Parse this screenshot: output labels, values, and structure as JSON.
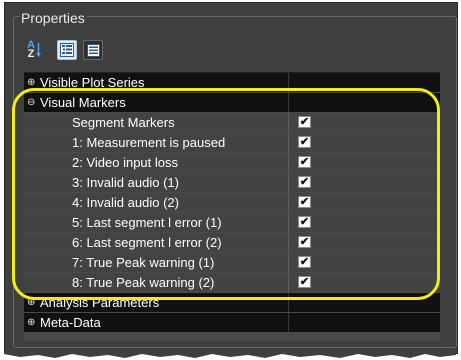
{
  "panel": {
    "title": "Properties"
  },
  "toolbar": {
    "sort_icon_top": "A",
    "sort_icon_bottom": "Z",
    "categorized_icon": "categorized-icon",
    "alphabetical_icon": "alphabetical-icon"
  },
  "grid": {
    "categories": {
      "visible_plot_series": "Visible Plot Series",
      "visual_markers": "Visual Markers",
      "analysis_parameters": "Analysis Parameters",
      "meta_data": "Meta-Data"
    },
    "visual_markers_items": [
      {
        "label": "Segment Markers",
        "checked": true
      },
      {
        "label": "1: Measurement is paused",
        "checked": true
      },
      {
        "label": "2: Video input loss",
        "checked": true
      },
      {
        "label": "3: Invalid audio (1)",
        "checked": true
      },
      {
        "label": "4: Invalid audio (2)",
        "checked": true
      },
      {
        "label": "5: Last segment l error (1)",
        "checked": true
      },
      {
        "label": "6: Last segment l error (2)",
        "checked": true
      },
      {
        "label": "7: True Peak warning (1)",
        "checked": true
      },
      {
        "label": "8: True Peak warning (2)",
        "checked": true
      }
    ]
  },
  "colors": {
    "panel_bg": "#3f3f3f",
    "category_row_bg": "#111111",
    "property_row_bg": "#434343",
    "annotation_highlight": "#f2ee14"
  }
}
